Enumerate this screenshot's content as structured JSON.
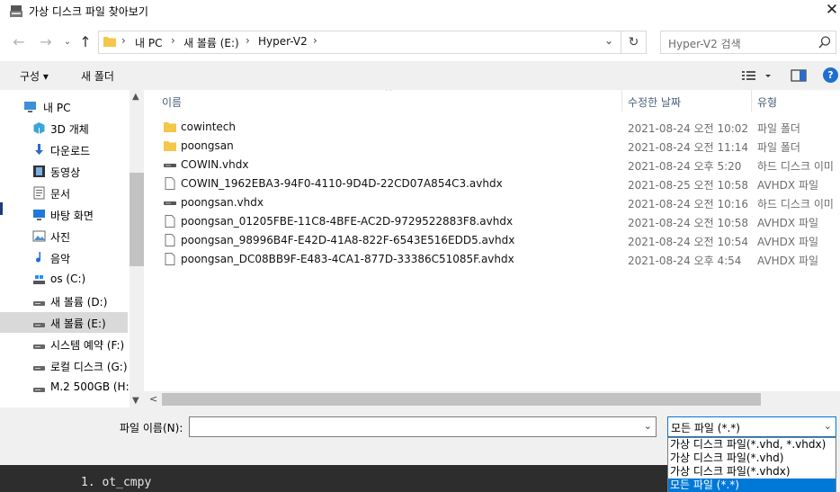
{
  "window": {
    "title": "가상 디스크 파일 찾아보기"
  },
  "nav": {
    "breadcrumbs": [
      "내 PC",
      "새 볼륨 (E:)",
      "Hyper-V2"
    ],
    "search_placeholder": "Hyper-V2 검색"
  },
  "toolbar": {
    "organize": "구성 ▾",
    "new_folder": "새 폴더"
  },
  "sidebar": {
    "items": [
      {
        "label": "내 PC",
        "icon": "pc-icon"
      },
      {
        "label": "3D 개체",
        "icon": "3d-objects-icon"
      },
      {
        "label": "다운로드",
        "icon": "download-icon"
      },
      {
        "label": "동영상",
        "icon": "video-icon"
      },
      {
        "label": "문서",
        "icon": "document-icon"
      },
      {
        "label": "바탕 화면",
        "icon": "desktop-icon"
      },
      {
        "label": "사진",
        "icon": "pictures-icon"
      },
      {
        "label": "음악",
        "icon": "music-icon"
      },
      {
        "label": "os (C:)",
        "icon": "drive-c-icon"
      },
      {
        "label": "새 볼륨 (D:)",
        "icon": "drive-icon"
      },
      {
        "label": "새 볼륨 (E:)",
        "icon": "drive-icon",
        "selected": true
      },
      {
        "label": "시스템 예약 (F:)",
        "icon": "drive-icon"
      },
      {
        "label": "로컬 디스크 (G:)",
        "icon": "drive-icon"
      },
      {
        "label": "M.2 500GB (H:)",
        "icon": "drive-icon"
      }
    ]
  },
  "columns": {
    "name": "이름",
    "date": "수정한 날짜",
    "type": "유형"
  },
  "files": [
    {
      "name": "cowintech",
      "date": "2021-08-24 오전 10:02",
      "type": "파일 폴더",
      "icon": "folder-icon"
    },
    {
      "name": "poongsan",
      "date": "2021-08-24 오전 11:14",
      "type": "파일 폴더",
      "icon": "folder-icon"
    },
    {
      "name": "COWIN.vhdx",
      "date": "2021-08-24 오후 5:20",
      "type": "하드 디스크 이미",
      "icon": "disk-image-icon"
    },
    {
      "name": "COWIN_1962EBA3-94F0-4110-9D4D-22CD07A854C3.avhdx",
      "date": "2021-08-25 오전 10:58",
      "type": "AVHDX 파일",
      "icon": "file-icon"
    },
    {
      "name": "poongsan.vhdx",
      "date": "2021-08-24 오전 10:16",
      "type": "하드 디스크 이미",
      "icon": "disk-image-icon"
    },
    {
      "name": "poongsan_01205FBE-11C8-4BFE-AC2D-9729522883F8.avhdx",
      "date": "2021-08-24 오전 10:58",
      "type": "AVHDX 파일",
      "icon": "file-icon"
    },
    {
      "name": "poongsan_98996B4F-E42D-41A8-822F-6543E516EDD5.avhdx",
      "date": "2021-08-24 오전 10:54",
      "type": "AVHDX 파일",
      "icon": "file-icon"
    },
    {
      "name": "poongsan_DC08BB9F-E483-4CA1-877D-33386C51085F.avhdx",
      "date": "2021-08-24 오후 4:54",
      "type": "AVHDX 파일",
      "icon": "file-icon"
    }
  ],
  "bottom": {
    "filename_label": "파일 이름(N):",
    "filename_value": "",
    "filetype_selected": "모든 파일 (*.*)",
    "filetype_options": [
      "가상 디스크 파일(*.vhd, *.vhdx)",
      "가상 디스크 파일(*.vhd)",
      "가상 디스크 파일(*.vhdx)",
      "모든 파일 (*.*)"
    ]
  },
  "background": {
    "text": "1. ot_cmpy"
  },
  "colors": {
    "accent": "#0078d7",
    "folder": "#f4c64a",
    "selection": "#d9d9d9"
  }
}
